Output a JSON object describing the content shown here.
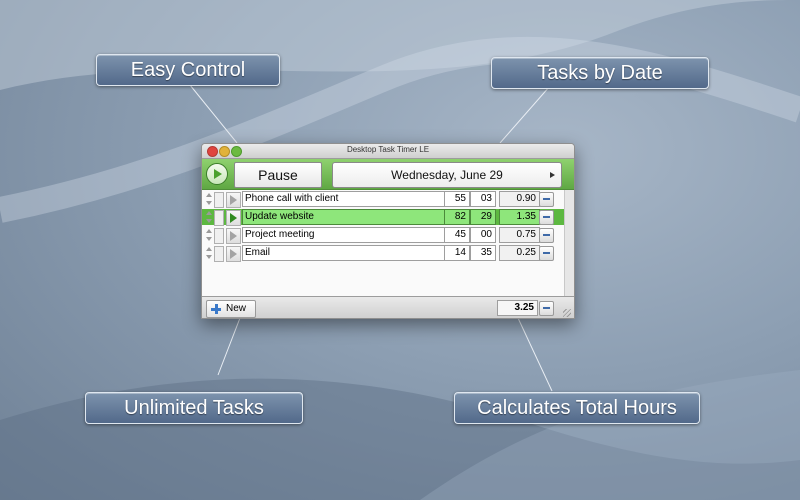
{
  "callouts": {
    "easy_control": "Easy Control",
    "tasks_by_date": "Tasks by Date",
    "unlimited_tasks": "Unlimited Tasks",
    "calculates_total": "Calculates Total Hours"
  },
  "window": {
    "title": "Desktop Task Timer LE",
    "pause_label": "Pause",
    "date_label": "Wednesday, June 29",
    "new_label": "New",
    "total_hours": "3.25"
  },
  "tasks": [
    {
      "name": "Phone call with client",
      "minutes": "55",
      "seconds": "03",
      "hours": "0.90",
      "active": false
    },
    {
      "name": "Update website",
      "minutes": "82",
      "seconds": "29",
      "hours": "1.35",
      "active": true
    },
    {
      "name": "Project meeting",
      "minutes": "45",
      "seconds": "00",
      "hours": "0.75",
      "active": false
    },
    {
      "name": "Email",
      "minutes": "14",
      "seconds": "35",
      "hours": "0.25",
      "active": false
    }
  ],
  "colors": {
    "toolbar_green": "#5fa843",
    "active_row_green": "#8ee67b",
    "callout_blue": "#52698a"
  }
}
